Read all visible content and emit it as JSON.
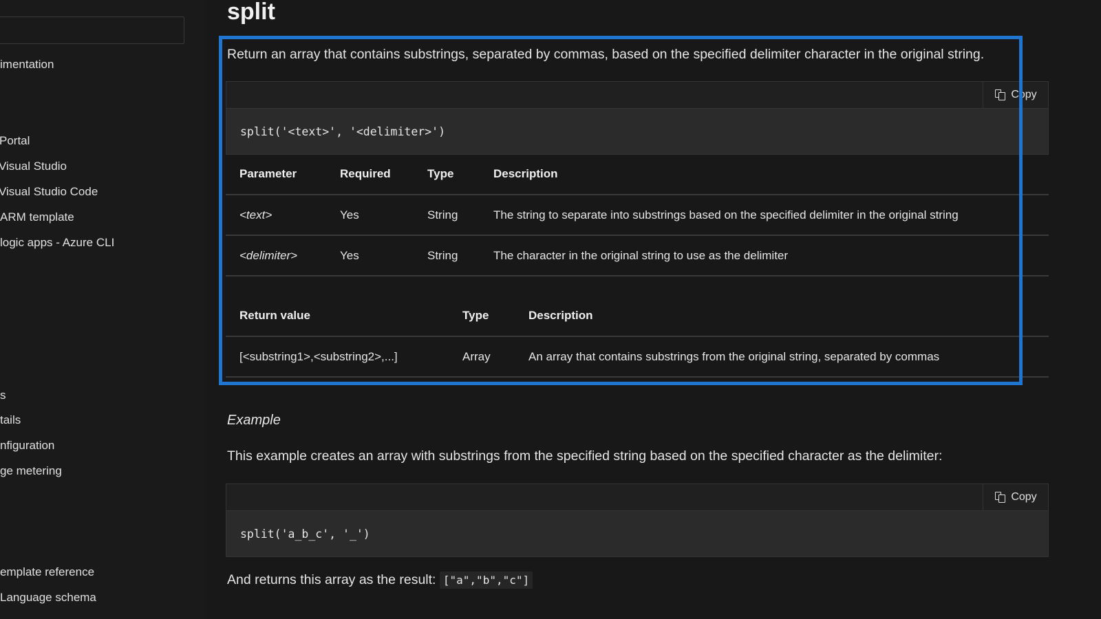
{
  "sidebar": {
    "filter_placeholder": "",
    "items": [
      {
        "label": "imentation"
      },
      {
        "label": "Portal"
      },
      {
        "label": "Visual Studio"
      },
      {
        "label": "Visual Studio Code"
      },
      {
        "label": "ARM template"
      },
      {
        "label": "logic apps - Azure CLI"
      },
      {
        "label": "s"
      },
      {
        "label": "tails"
      },
      {
        "label": "nfiguration"
      },
      {
        "label": "ge metering"
      },
      {
        "label": "emplate reference"
      },
      {
        "label": " Language schema"
      }
    ]
  },
  "main": {
    "title": "split",
    "highlight_color": "#1f75cf",
    "summary": "Return an array that contains substrings, separated by commas, based on the specified delimiter character in the original string.",
    "syntax": {
      "copy_label": "Copy",
      "code": "split('<text>', '<delimiter>')"
    },
    "params_table": {
      "headers": [
        "Parameter",
        "Required",
        "Type",
        "Description"
      ],
      "rows": [
        {
          "parameter": "<text>",
          "required": "Yes",
          "type": "String",
          "description": "The string to separate into substrings based on the specified delimiter in the original string"
        },
        {
          "parameter": "<delimiter>",
          "required": "Yes",
          "type": "String",
          "description": "The character in the original string to use as the delimiter"
        }
      ]
    },
    "return_table": {
      "headers": [
        "Return value",
        "Type",
        "Description"
      ],
      "rows": [
        {
          "value": "[<substring1>,<substring2>,...]",
          "type": "Array",
          "description": "An array that contains substrings from the original string, separated by commas"
        }
      ]
    },
    "example": {
      "heading": "Example",
      "intro": "This example creates an array with substrings from the specified string based on the specified character as the delimiter:",
      "copy_label": "Copy",
      "code": "split('a_b_c', '_')",
      "result_prefix": "And returns this array as the result: ",
      "result_code": "[\"a\",\"b\",\"c\"]"
    }
  }
}
